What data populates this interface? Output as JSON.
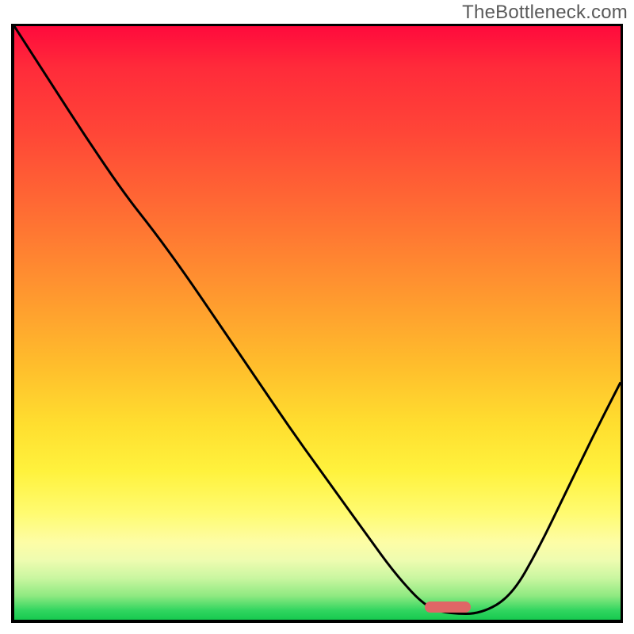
{
  "watermark": "TheBottleneck.com",
  "marker": {
    "color": "#e06666",
    "x_frac": 0.715,
    "y_frac": 0.978,
    "w": 58,
    "h": 14
  },
  "chart_data": {
    "type": "line",
    "title": "",
    "xlabel": "",
    "ylabel": "",
    "xlim": [
      0,
      1
    ],
    "ylim": [
      0,
      1
    ],
    "legend": false,
    "grid": false,
    "background_gradient": {
      "direction": "vertical",
      "stops": [
        {
          "pos": 0.0,
          "color": "#ff0a3c"
        },
        {
          "pos": 0.3,
          "color": "#ff7a32"
        },
        {
          "pos": 0.6,
          "color": "#ffd22d"
        },
        {
          "pos": 0.82,
          "color": "#fffb70"
        },
        {
          "pos": 0.93,
          "color": "#c9f6a0"
        },
        {
          "pos": 1.0,
          "color": "#17c94f"
        }
      ]
    },
    "annotations": [
      {
        "text": "TheBottleneck.com",
        "position": "top-right"
      }
    ],
    "series": [
      {
        "name": "bottleneck-curve",
        "color": "#000000",
        "stroke_width": 3,
        "x": [
          0.0,
          0.06,
          0.12,
          0.18,
          0.23,
          0.28,
          0.34,
          0.4,
          0.46,
          0.52,
          0.58,
          0.63,
          0.68,
          0.72,
          0.77,
          0.82,
          0.865,
          0.91,
          0.955,
          1.0
        ],
        "y": [
          1.0,
          0.905,
          0.81,
          0.72,
          0.655,
          0.585,
          0.495,
          0.405,
          0.315,
          0.23,
          0.145,
          0.075,
          0.02,
          0.01,
          0.01,
          0.04,
          0.12,
          0.215,
          0.31,
          0.4
        ]
      }
    ],
    "markers": [
      {
        "shape": "rounded-bar",
        "color": "#e06666",
        "x": 0.715,
        "y": 0.022,
        "w_frac": 0.076,
        "h_frac": 0.019
      }
    ]
  }
}
